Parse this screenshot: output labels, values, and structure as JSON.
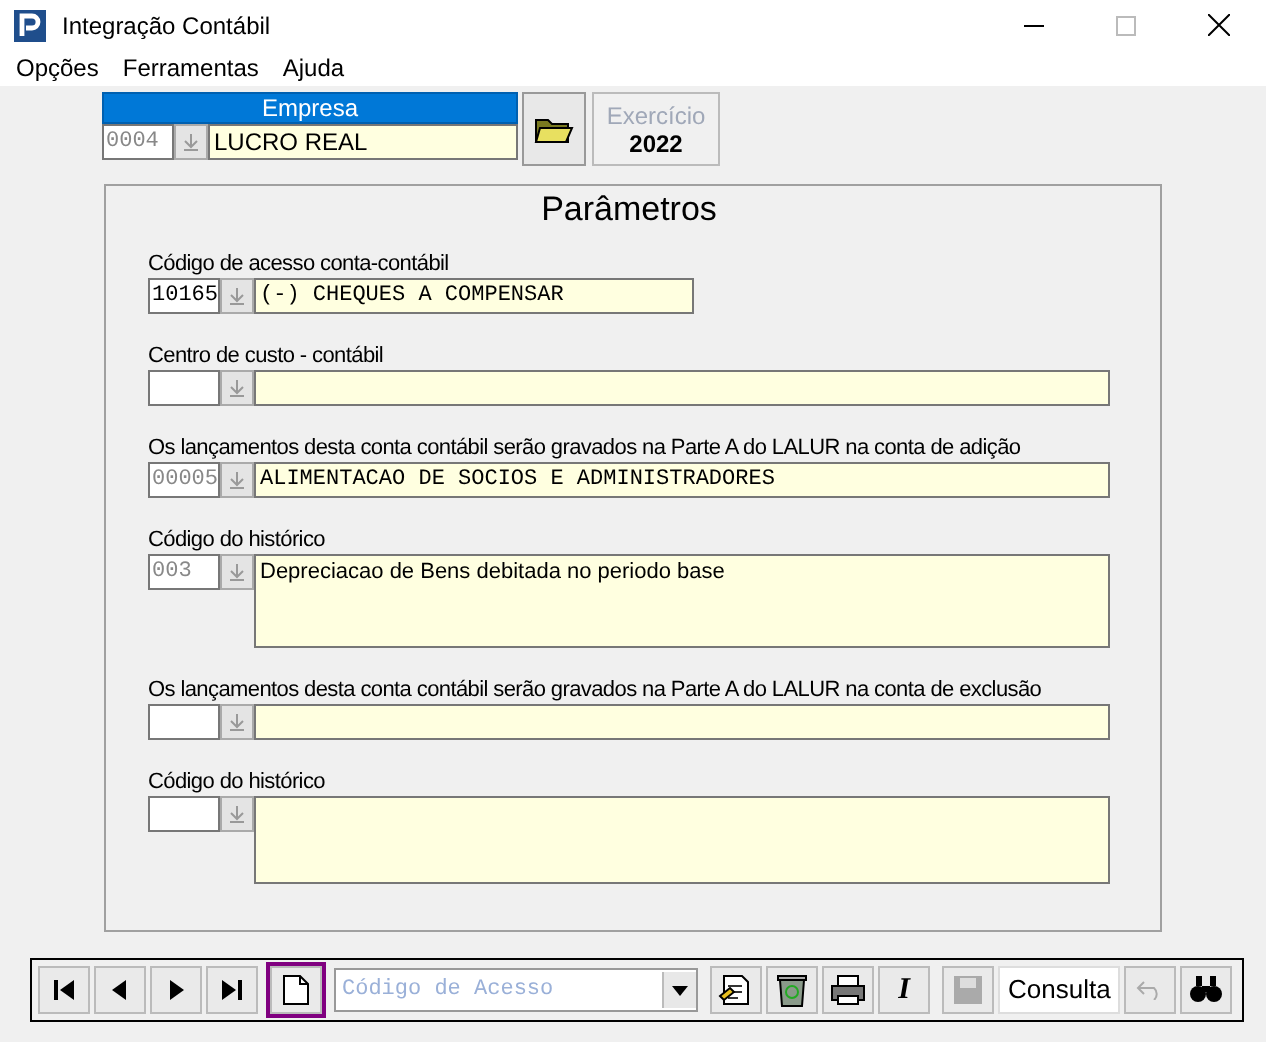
{
  "window": {
    "title": "Integração Contábil"
  },
  "menu": [
    "Opções",
    "Ferramentas",
    "Ajuda"
  ],
  "empresa": {
    "header": "Empresa",
    "code": "0004",
    "name": "LUCRO REAL"
  },
  "exercicio": {
    "label": "Exercício",
    "value": "2022"
  },
  "parametros": {
    "title": "Parâmetros",
    "fields": [
      {
        "kind": "short",
        "label": "Código de acesso conta-contábil",
        "code": "10165",
        "disabled": false,
        "description": "(-) CHEQUES A COMPENSAR"
      },
      {
        "kind": "wide",
        "label": "Centro de custo - contábil"
      },
      {
        "kind": "wide",
        "label": "Os lançamentos desta conta contábil serão gravados na Parte A do LALUR na conta de adição",
        "code": "00005",
        "disabled": true,
        "description": "ALIMENTACAO DE SOCIOS E ADMINISTRADORES"
      },
      {
        "kind": "memo",
        "label": "Código do histórico",
        "code": "003",
        "disabled": true,
        "description": "Depreciacao de Bens debitada no periodo base"
      },
      {
        "kind": "wide",
        "label": "Os lançamentos desta conta contábil serão gravados na Parte A do LALUR na conta de exclusão"
      },
      {
        "kind": "memo",
        "label": "Código do histórico"
      }
    ]
  },
  "toolbar": {
    "combo_placeholder": "Código de Acesso",
    "italic_key": "I",
    "mode": "Consulta",
    "new_selected": true,
    "save_disabled": true,
    "undo_disabled": true
  }
}
